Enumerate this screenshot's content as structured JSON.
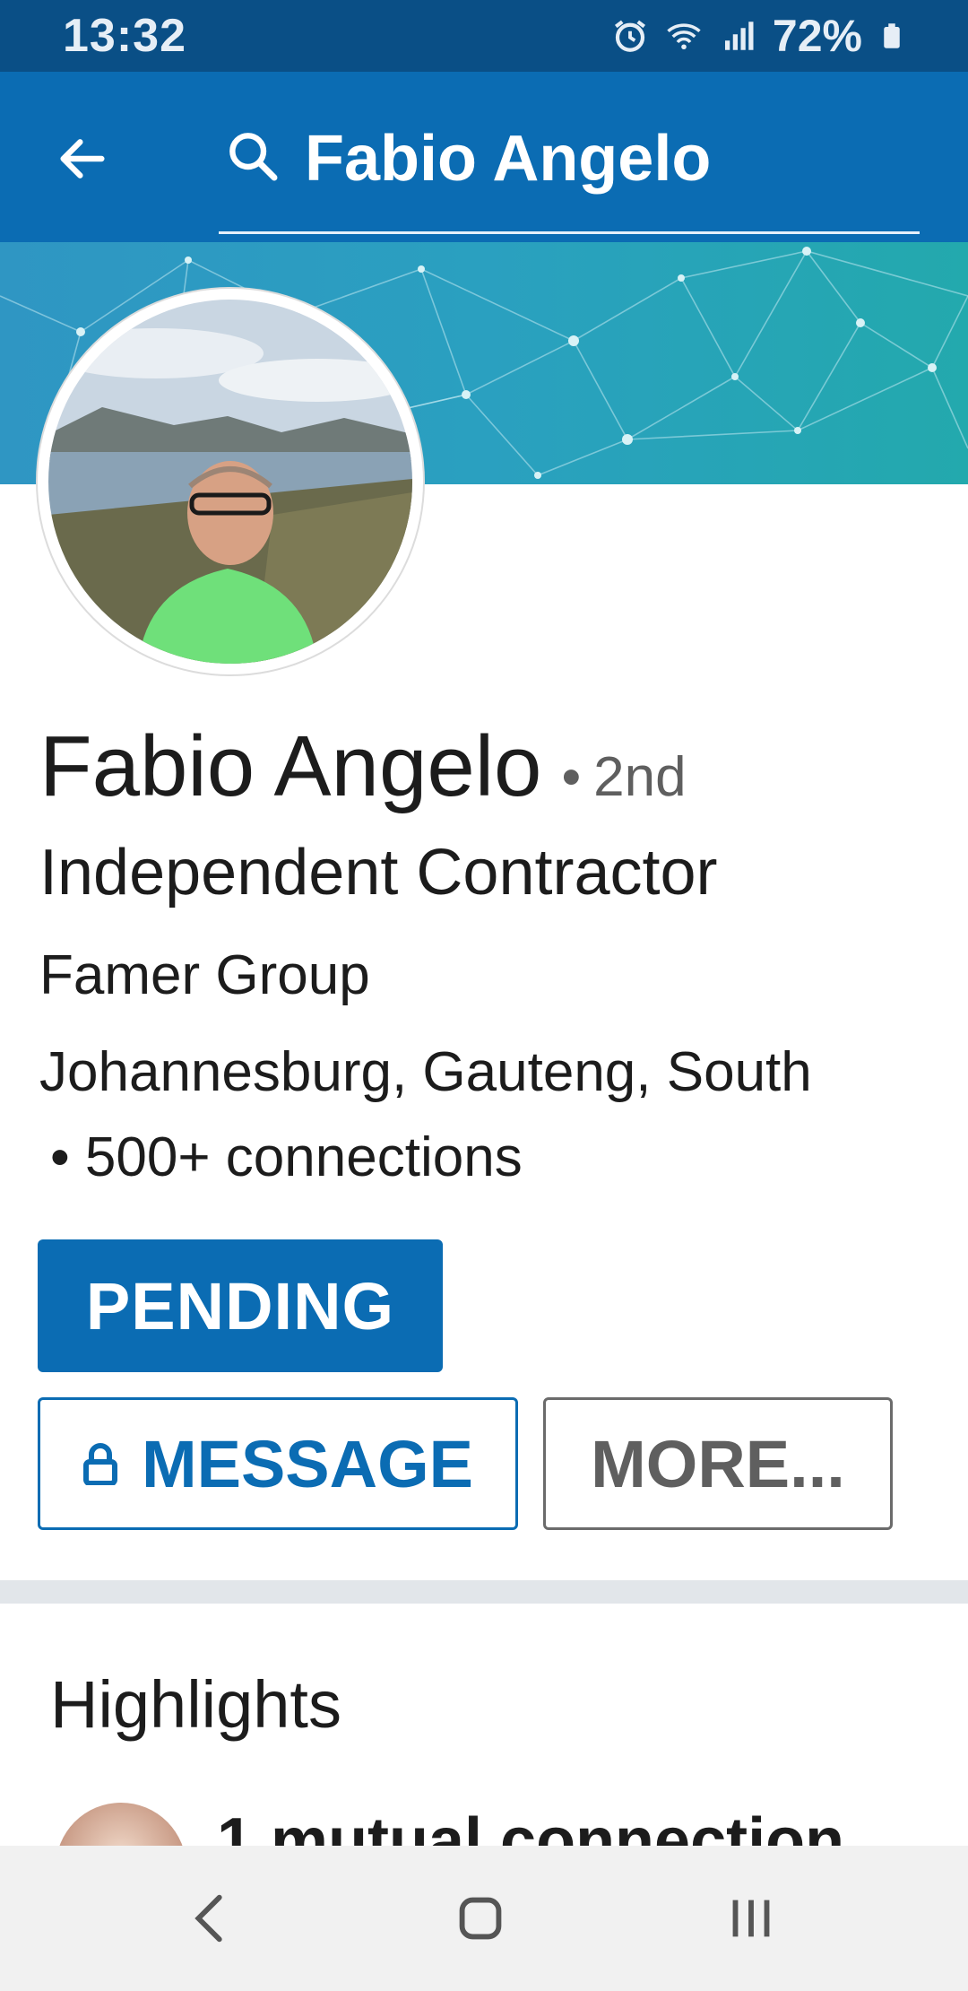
{
  "status_bar": {
    "time": "13:32",
    "battery": "72%",
    "icons": [
      "alarm-icon",
      "wifi-icon",
      "signal-icon",
      "battery-icon"
    ]
  },
  "app_bar": {
    "back_icon": "arrow-back-icon",
    "search_icon": "search-icon",
    "search_text": "Fabio Angelo",
    "color": "#0b6cb3"
  },
  "profile": {
    "name": "Fabio Angelo",
    "degree_separator": "•",
    "degree": "2nd",
    "headline": "Independent Contractor",
    "company": "Famer Group",
    "location": "Johannesburg, Gauteng, South",
    "connections": "• 500+ connections"
  },
  "actions": {
    "pending_label": "PENDING",
    "message_label": "MESSAGE",
    "more_label": "MORE..."
  },
  "highlights": {
    "title": "Highlights",
    "mutual_text": "1 mutual connection"
  },
  "nav": {
    "icons": [
      "nav-back-icon",
      "nav-home-icon",
      "nav-recents-icon"
    ]
  }
}
